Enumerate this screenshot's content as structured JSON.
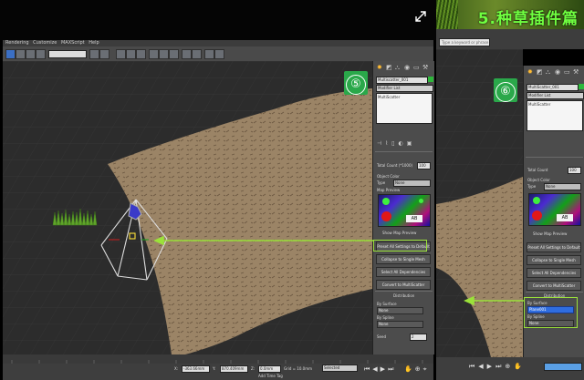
{
  "banner": {
    "title": "5.种草插件篇"
  },
  "left_window": {
    "menu": [
      "Rendering",
      "Customize",
      "MAXScript",
      "Help"
    ],
    "step_badge": "⑤",
    "panel": {
      "object_name": "Multiscatter_001",
      "modifier_list": "Modifier List",
      "stack_item": "MultiScatter",
      "count_label": "Total Count (*1000)",
      "count_value": "100",
      "object_color_label": "Object Color",
      "color_type_label": "Type",
      "color_type_value": "None",
      "map_preview_label": "Map Preview",
      "show_map_preview": "Show Map Preview",
      "main_button": "Preset All Settings to Default",
      "buttons": [
        "Collapse to Single Mesh",
        "Select All Dependencies",
        "Convert to MultiScatter"
      ],
      "distribution_header": "Distribution",
      "by_surface_label": "By Surface",
      "by_surface_value": "None",
      "by_spline_label": "By Spline",
      "by_spline_value": "None",
      "seed_label": "Seed",
      "seed_value": "2"
    },
    "status": {
      "x_label": "X:",
      "x_value": "-363.66mm",
      "y_label": "Y:",
      "y_value": "870.409mm",
      "z_label": "Z:",
      "z_value": "0.0mm",
      "grid": "Grid = 10.0mm",
      "add_time_tag": "Add Time Tag",
      "selected": "Selected"
    }
  },
  "right_window": {
    "search_placeholder": "Type a keyword or phrase",
    "step_badge": "⑥",
    "panel": {
      "object_name": "MultiScatter_001",
      "modifier_list": "Modifier List",
      "stack_item": "MultiScatter",
      "count_label": "Total Count",
      "count_value": "100",
      "object_color_label": "Object Color",
      "color_type_label": "Type",
      "color_type_value": "None",
      "show_map_preview": "Show Map Preview",
      "main_button": "Preset All Settings to Default",
      "buttons": [
        "Collapse to Single Mesh",
        "Select All Dependencies",
        "Convert to MultiScatter"
      ],
      "distribution_header": "Distribution",
      "by_surface_label": "By Surface",
      "by_surface_value": "Plane001",
      "by_spline_label": "By Spline",
      "by_spline_value": "None"
    }
  }
}
